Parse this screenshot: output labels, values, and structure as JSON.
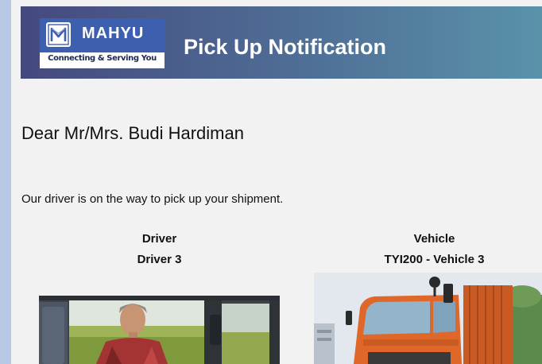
{
  "header": {
    "brand": "MAHYU",
    "tagline": "Connecting & Serving You",
    "title": "Pick Up Notification",
    "logo_icon": "m-monogram-icon",
    "gradient_colors": [
      "#45497e",
      "#5a92aa"
    ]
  },
  "greeting": "Dear Mr/Mrs. Budi Hardiman",
  "message": "Our driver is on the way to pick up your shipment.",
  "driver": {
    "heading": "Driver",
    "name": "Driver 3",
    "photo": "driver-in-truck-cab-photo"
  },
  "vehicle": {
    "heading": "Vehicle",
    "name": "TYI200 - Vehicle 3",
    "photo": "orange-dump-truck-photo"
  },
  "colors": {
    "background": "#b7c9e6",
    "card": "#f2f2f2",
    "logo_blue": "#3d5fb0",
    "truck_orange": "#e0672a"
  }
}
